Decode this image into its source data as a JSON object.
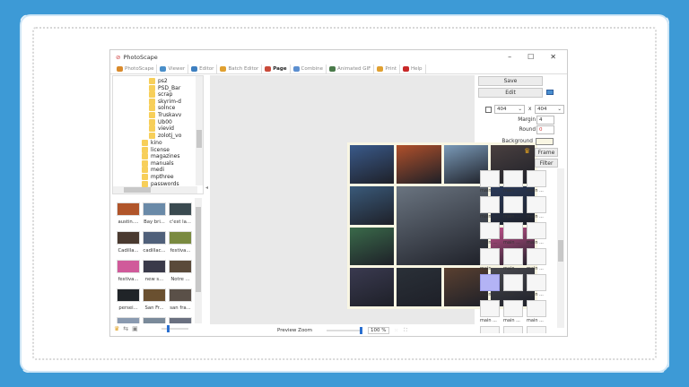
{
  "window": {
    "title": "PhotoScape",
    "controls": [
      "–",
      "☐",
      "✕"
    ]
  },
  "tabs": [
    {
      "label": "PhotoScape",
      "color": "#d98a2b"
    },
    {
      "label": "Viewer",
      "color": "#4a8fc9"
    },
    {
      "label": "Editor",
      "color": "#3d7fc0"
    },
    {
      "label": "Batch Editor",
      "color": "#e0a030"
    },
    {
      "label": "Page",
      "color": "#c94a3a",
      "active": true
    },
    {
      "label": "Combine",
      "color": "#5c8fd0"
    },
    {
      "label": "Animated GIF",
      "color": "#4a7a4a"
    },
    {
      "label": "Print",
      "color": "#e0a030"
    },
    {
      "label": "Help",
      "color": "#c82828"
    }
  ],
  "tree": {
    "sub": [
      "ps2",
      "PSD_Bar",
      "scrap",
      "skyrim-d",
      "solnce",
      "Truskavv",
      "Ub00",
      "vievid",
      "zolotj_vo"
    ],
    "top": [
      "kino",
      "license",
      "magazines",
      "manuals",
      "medi",
      "mpthree",
      "passwords"
    ]
  },
  "thumbnails": [
    "austin....",
    "Bay bri...",
    "c'est la...",
    "Cadilla...",
    "cadillac...",
    "festiva...",
    "festiva...",
    "new s...",
    "Notre ...",
    "persei...",
    "San Fr...",
    "san fra..."
  ],
  "right": {
    "save": "Save",
    "edit": "Edit",
    "width": "404",
    "height": "404",
    "x": "x",
    "margin_label": "Margin",
    "margin": "4",
    "round_label": "Round",
    "round": "0",
    "background_label": "Background",
    "background_color": "#f9f6e3",
    "frame": "Frame",
    "filter": "Filter",
    "layout_label": "main ...",
    "selected_layout": 12
  },
  "status": {
    "preview_zoom": "Preview Zoom",
    "zoom": "100 %",
    "zoom_level": 1.0
  },
  "colors": {
    "page_bg": "#3d9ad6",
    "accent": "#3d7fc0"
  }
}
